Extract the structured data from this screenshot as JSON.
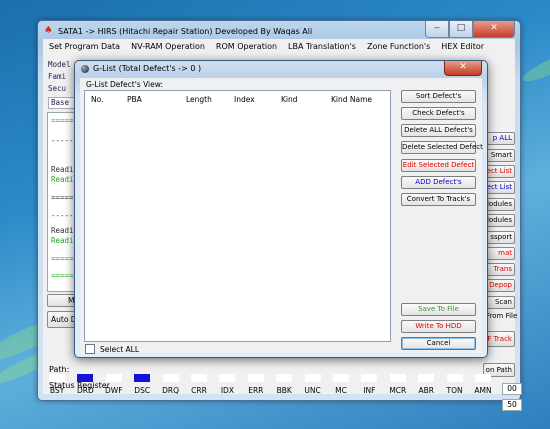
{
  "window": {
    "title": "SATA1 -> HIRS (Hitachi Repair Station) Developed By Waqas Ali"
  },
  "menu": [
    "Set Program Data",
    "NV-RAM Operation",
    "ROM Operation",
    "LBA Translation's",
    "Zone Function's",
    "HEX Editor"
  ],
  "info_panel": {
    "model": "Model",
    "family": "Fami",
    "security": "Secu",
    "base_tab": "Base"
  },
  "log_lines": [
    {
      "text": "=====",
      "color": "green"
    },
    {
      "text": "-----",
      "color": "dark"
    },
    {
      "text": "Readi",
      "color": "dark"
    },
    {
      "text": "Readi",
      "color": "green"
    },
    {
      "text": "=====",
      "color": "dark"
    },
    {
      "text": "-----",
      "color": "dark"
    },
    {
      "text": "Readi",
      "color": "dark"
    },
    {
      "text": "Readi",
      "color": "green"
    },
    {
      "text": "=====",
      "color": "green"
    },
    {
      "text": "=====",
      "color": "green"
    }
  ],
  "left_buttons": {
    "mi": "Mi",
    "auto": "Auto De"
  },
  "side_buttons": [
    {
      "label": "p ALL",
      "color": "blue"
    },
    {
      "label": "Smart",
      "color": "dark"
    },
    {
      "label": "fect List",
      "color": "red"
    },
    {
      "label": "fect List",
      "color": "blue"
    },
    {
      "label": "lodules",
      "color": "dark"
    },
    {
      "label": "lodules",
      "color": "dark"
    },
    {
      "label": "ssport",
      "color": "dark"
    },
    {
      "label": "mat",
      "color": "red"
    },
    {
      "label": "Trans",
      "color": "red"
    },
    {
      "label": "Depop",
      "color": "red"
    },
    {
      "label": "Scan",
      "color": "dark"
    }
  ],
  "right_labels": {
    "from_file": "From File",
    "track": "F Track",
    "path_btn": "on Path"
  },
  "path_label": "Path:",
  "status_label": "Status Register",
  "status_register": [
    {
      "name": "BSY",
      "on": false
    },
    {
      "name": "DRD",
      "on": true
    },
    {
      "name": "DWF",
      "on": false
    },
    {
      "name": "DSC",
      "on": true
    },
    {
      "name": "DRQ",
      "on": false
    },
    {
      "name": "CRR",
      "on": false
    },
    {
      "name": "IDX",
      "on": false
    },
    {
      "name": "ERR",
      "on": false
    },
    {
      "name": "BBK",
      "on": false
    },
    {
      "name": "UNC",
      "on": false
    },
    {
      "name": "MC",
      "on": false
    },
    {
      "name": "INF",
      "on": false
    },
    {
      "name": "MCR",
      "on": false
    },
    {
      "name": "ABR",
      "on": false
    },
    {
      "name": "TON",
      "on": false
    },
    {
      "name": "AMN",
      "on": false
    }
  ],
  "number_boxes": [
    "00",
    "50"
  ],
  "dialog": {
    "title": "G-List (Total Defect's -> 0 )",
    "group_label": "G-List Defect's View:",
    "columns": [
      "No.",
      "PBA",
      "Length",
      "Index",
      "Kind",
      "Kind Name"
    ],
    "select_all": "Select ALL",
    "buttons": [
      {
        "label": "Sort Defect's",
        "color": "dark"
      },
      {
        "label": "Check Defect's",
        "color": "dark"
      },
      {
        "label": "Delete ALL Defect's",
        "color": "dark"
      },
      {
        "label": "Delete Selected Defect",
        "color": "dark"
      },
      {
        "label": "Edit Selected Defect",
        "color": "red"
      },
      {
        "label": "ADD Defect's",
        "color": "blue"
      },
      {
        "label": "Convert To Track's",
        "color": "dark"
      }
    ],
    "bottom_buttons": [
      {
        "label": "Save To File",
        "color": "green"
      },
      {
        "label": "Write To HDD",
        "color": "red"
      },
      {
        "label": "Cancel",
        "color": "dark"
      }
    ]
  },
  "colors": {
    "indicator_on": "#1414d8",
    "red_text": "#dd0000",
    "blue_text": "#0000cc",
    "green_text": "#339933"
  }
}
